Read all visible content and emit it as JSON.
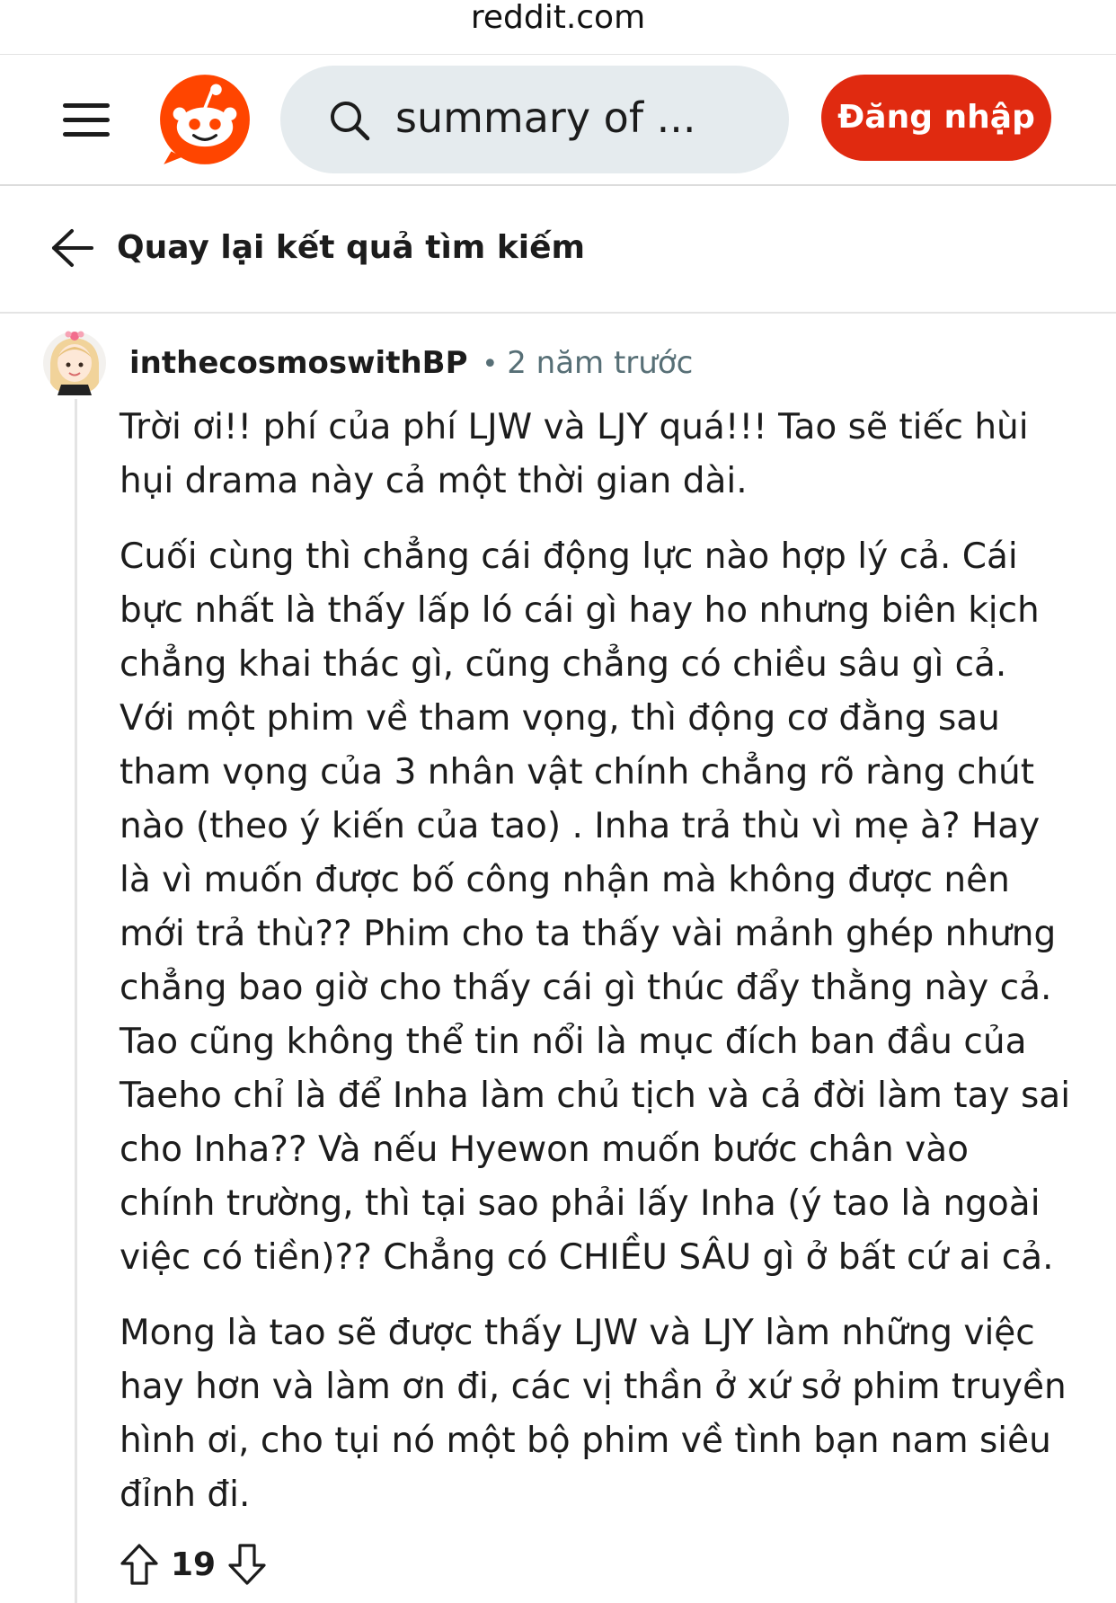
{
  "browser": {
    "url": "reddit.com"
  },
  "header": {
    "menu_icon": "hamburger-menu-icon",
    "logo_icon": "reddit-snoo-logo",
    "search_icon": "search-icon",
    "search_value": "summary of ...",
    "login_label": "Đăng nhập",
    "brand_color": "#e02a10"
  },
  "nav": {
    "back_icon": "arrow-left-icon",
    "back_label": "Quay lại kết quả tìm kiếm"
  },
  "comment": {
    "username": "inthecosmoswithBP",
    "separator": "•",
    "timestamp": "2 năm trước",
    "paragraphs": [
      "Trời ơi!! phí của phí LJW và LJY quá!!! Tao sẽ tiếc hùi hụi drama này cả một thời gian dài.",
      "Cuối cùng thì chẳng cái động lực nào hợp lý cả. Cái bực nhất là thấy lấp ló cái gì hay ho nhưng biên kịch chẳng khai thác gì, cũng chẳng có chiều sâu gì cả. Với một phim về tham vọng, thì động cơ đằng sau tham vọng của 3 nhân vật chính chẳng rõ ràng chút nào (theo ý kiến của tao) . Inha trả thù vì mẹ à? Hay là vì muốn được bố công nhận mà không được nên mới trả thù?? Phim cho ta thấy vài mảnh ghép nhưng chẳng bao giờ cho thấy cái gì thúc đẩy thằng này cả. Tao cũng không thể tin nổi là mục đích ban đầu của Taeho chỉ là để Inha làm chủ tịch và cả đời làm tay sai cho Inha?? Và nếu Hyewon muốn bước chân vào chính trường, thì tại sao phải lấy Inha (ý tao là ngoài việc có tiền)?? Chẳng có CHIỀU SÂU gì ở bất cứ ai cả.",
      "Mong là tao sẽ được thấy LJW và LJY làm những việc hay hơn và làm ơn đi, các vị thần ở xứ sở phim truyền hình ơi, cho tụi nó một bộ phim về tình bạn nam siêu đỉnh đi."
    ],
    "score": "19",
    "upvote_icon": "upvote-arrow-icon",
    "downvote_icon": "downvote-arrow-icon"
  }
}
